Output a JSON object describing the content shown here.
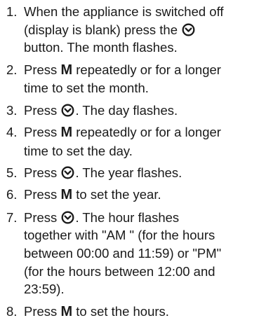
{
  "steps": [
    {
      "number": "1.",
      "lines": [
        {
          "text": "When the appliance is switched off"
        },
        {
          "text": "(display is blank) press the",
          "icon_after": "timer-button-icon"
        },
        {
          "text": "button. The month flashes."
        }
      ]
    },
    {
      "number": "2.",
      "lines": [
        {
          "before": "Press",
          "key": "M",
          "after": "repeatedly or for a longer"
        },
        {
          "text": "time to set the month."
        }
      ]
    },
    {
      "number": "3.",
      "lines": [
        {
          "before": "Press",
          "icon": "timer-button-icon",
          "after": ". The day flashes."
        }
      ]
    },
    {
      "number": "4.",
      "lines": [
        {
          "before": "Press",
          "key": "M",
          "after": "repeatedly or for a longer"
        },
        {
          "text": "time to set the day."
        }
      ]
    },
    {
      "number": "5.",
      "lines": [
        {
          "before": "Press",
          "icon": "timer-button-icon",
          "after": ". The year flashes."
        }
      ]
    },
    {
      "number": "6.",
      "lines": [
        {
          "before": "Press",
          "key": "M",
          "after": " to set the year."
        }
      ]
    },
    {
      "number": "7.",
      "lines": [
        {
          "before": "Press",
          "icon": "timer-button-icon",
          "after": ". The hour flashes"
        },
        {
          "text": "together with \"AM \" (for the hours"
        },
        {
          "text": "between 00:00 and 11:59) or \"PM\""
        },
        {
          "text": "(for the hours between 12:00 and"
        },
        {
          "text": "23:59)."
        }
      ]
    },
    {
      "number": "8.",
      "lines": [
        {
          "before": "Press",
          "key": "M",
          "after": " to set the hours."
        }
      ]
    }
  ]
}
